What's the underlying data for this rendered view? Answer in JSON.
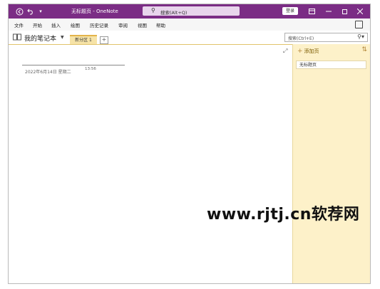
{
  "titlebar": {
    "title": "无标题页 - OneNote",
    "search_placeholder": "搜索(Alt+Q)",
    "login_label": "登录"
  },
  "menu": {
    "items": [
      "文件",
      "开始",
      "插入",
      "绘图",
      "历史记录",
      "审阅",
      "视图",
      "帮助"
    ]
  },
  "notebook": {
    "name": "我的笔记本",
    "section_tab": "新分区 1",
    "add_section": "+"
  },
  "page_search": {
    "placeholder": "搜索(Ctrl+E)"
  },
  "page": {
    "date": "2022年6月14日  星期二",
    "time": "13:56"
  },
  "pages_panel": {
    "add_page_label": "添加页",
    "items": [
      "无标题页"
    ]
  },
  "watermark": "www.rjtj.cn软荐网",
  "colors": {
    "titlebar": "#7b2d85",
    "section_tab": "#f6e3a7",
    "pages_panel": "#fdf1c9"
  }
}
